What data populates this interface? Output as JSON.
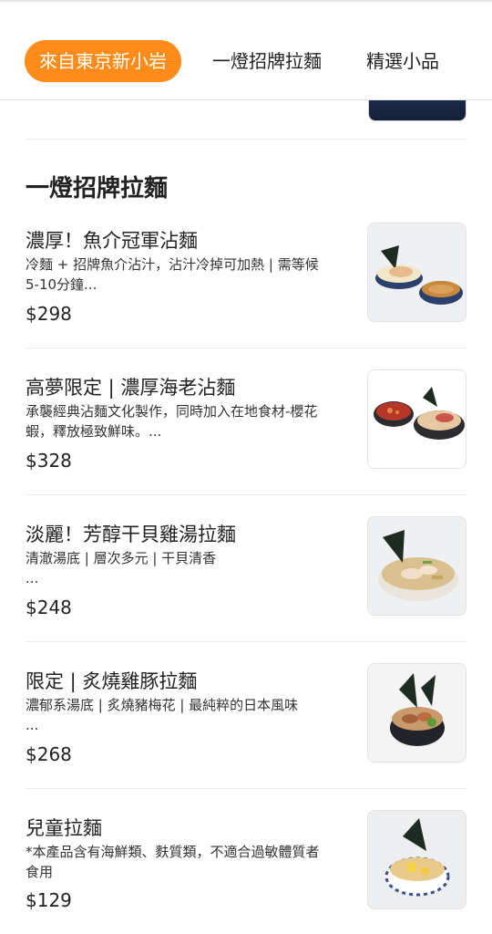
{
  "tabs": [
    {
      "label": "來自東京新小岩",
      "active": true
    },
    {
      "label": "一燈招牌拉麵",
      "active": false
    },
    {
      "label": "精選小品",
      "active": false
    }
  ],
  "section": {
    "title": "一燈招牌拉麵"
  },
  "items": [
    {
      "name": "濃厚！魚介冠軍沾麵",
      "desc_lines": [
        "冷麵 + 招牌魚介沾汁，沾汁冷掉可加熱 | 需等候",
        "5-10分鐘..."
      ],
      "price": "$298",
      "image": "tsukemen-photo"
    },
    {
      "name": "高夢限定 | 濃厚海老沾麵",
      "desc_lines": [
        "承襲經典沾麵文化製作，同時加入在地食材-櫻花",
        "蝦，釋放極致鮮味。..."
      ],
      "price": "$328",
      "image": "shrimp-tsukemen-photo"
    },
    {
      "name": "淡麗！芳醇干貝雞湯拉麵",
      "desc_lines": [
        "清澈湯底 | 層次多元 | 干貝清香",
        "..."
      ],
      "price": "$248",
      "image": "scallop-ramen-photo"
    },
    {
      "name": "限定 | 炙燒雞豚拉麵",
      "desc_lines": [
        "濃郁系湯底 | 炙燒豬梅花 | 最純粹的日本風味",
        "..."
      ],
      "price": "$268",
      "image": "chicken-pork-ramen-photo"
    },
    {
      "name": "兒童拉麵",
      "desc_lines": [
        "*本產品含有海鮮類、麩質類，不適合過敏體質者",
        "食用"
      ],
      "price": "$129",
      "image": "kids-ramen-photo"
    }
  ],
  "colors": {
    "accent": "#ff8c1a",
    "text": "#222222",
    "divider": "#ececec"
  }
}
